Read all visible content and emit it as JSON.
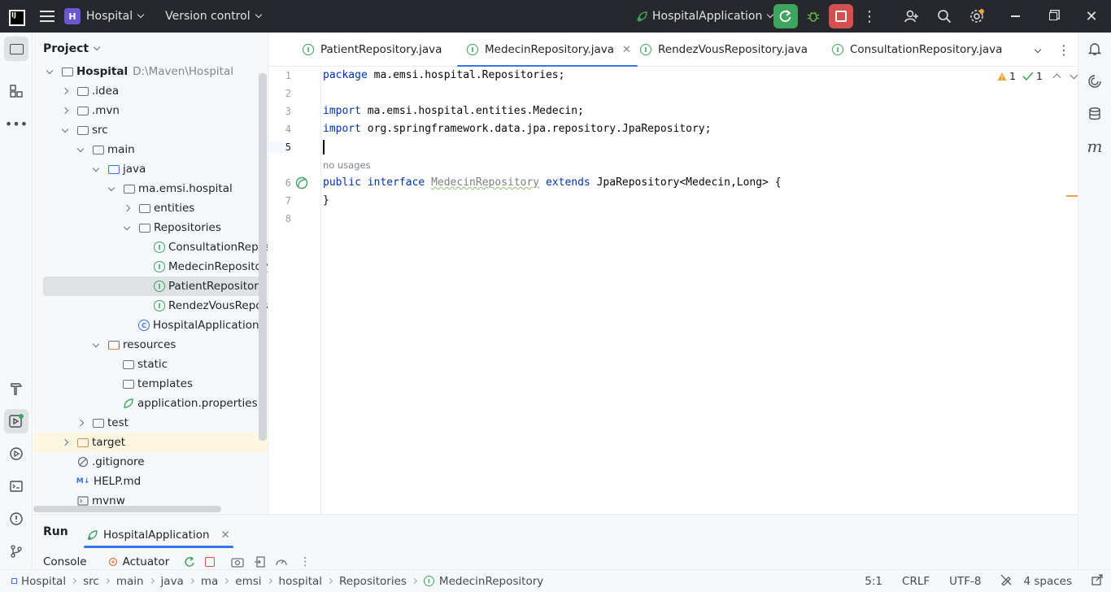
{
  "titlebar": {
    "project_badge": "H",
    "project_name": "Hospital",
    "vcs_label": "Version control",
    "run_config": "HospitalApplication"
  },
  "project_panel": {
    "title": "Project",
    "tree": [
      {
        "label": "Hospital",
        "hint": "D:\\Maven\\Hospital"
      },
      {
        "label": ".idea"
      },
      {
        "label": ".mvn"
      },
      {
        "label": "src"
      },
      {
        "label": "main"
      },
      {
        "label": "java"
      },
      {
        "label": "ma.emsi.hospital"
      },
      {
        "label": "entities"
      },
      {
        "label": "Repositories"
      },
      {
        "label": "ConsultationRepository"
      },
      {
        "label": "MedecinRepository"
      },
      {
        "label": "PatientRepository"
      },
      {
        "label": "RendezVousRepository"
      },
      {
        "label": "HospitalApplication"
      },
      {
        "label": "resources"
      },
      {
        "label": "static"
      },
      {
        "label": "templates"
      },
      {
        "label": "application.properties"
      },
      {
        "label": "test"
      },
      {
        "label": "target"
      },
      {
        "label": ".gitignore"
      },
      {
        "label": "HELP.md"
      },
      {
        "label": "mvnw"
      }
    ]
  },
  "editor": {
    "tabs": [
      {
        "label": "PatientRepository.java"
      },
      {
        "label": "MedecinRepository.java"
      },
      {
        "label": "RendezVousRepository.java"
      },
      {
        "label": "ConsultationRepository.java"
      }
    ],
    "inspections": {
      "warnings": "1",
      "ok": "1"
    },
    "line_numbers": [
      "1",
      "2",
      "3",
      "4",
      "5",
      "6",
      "7",
      "8"
    ],
    "code": {
      "l1_kw": "package",
      "l1_rest": " ma.emsi.hospital.Repositories;",
      "l3_kw": "import",
      "l3_rest": " ma.emsi.hospital.entities.Medecin;",
      "l4_kw": "import",
      "l4_rest": " org.springframework.data.jpa.repository.JpaRepository;",
      "inlay": "no usages",
      "l6_kw1": "public",
      "l6_kw2": "interface",
      "l6_name": "MedecinRepository",
      "l6_kw3": "extends",
      "l6_rest": " JpaRepository<Medecin,Long> {",
      "l7": "}"
    }
  },
  "run_panel": {
    "title": "Run",
    "tab_label": "HospitalApplication",
    "console_label": "Console",
    "actuator_label": "Actuator"
  },
  "statusbar": {
    "breadcrumbs": [
      "Hospital",
      "src",
      "main",
      "java",
      "ma",
      "emsi",
      "hospital",
      "Repositories",
      "MedecinRepository"
    ],
    "position": "5:1",
    "line_sep": "CRLF",
    "encoding": "UTF-8",
    "indent": "4 spaces"
  },
  "colors": {
    "accent": "#3574f0",
    "titlebar_bg": "#27282e",
    "run_green": "#3fa45f",
    "stop_red": "#d64f4f",
    "keyword": "#0033b3"
  }
}
